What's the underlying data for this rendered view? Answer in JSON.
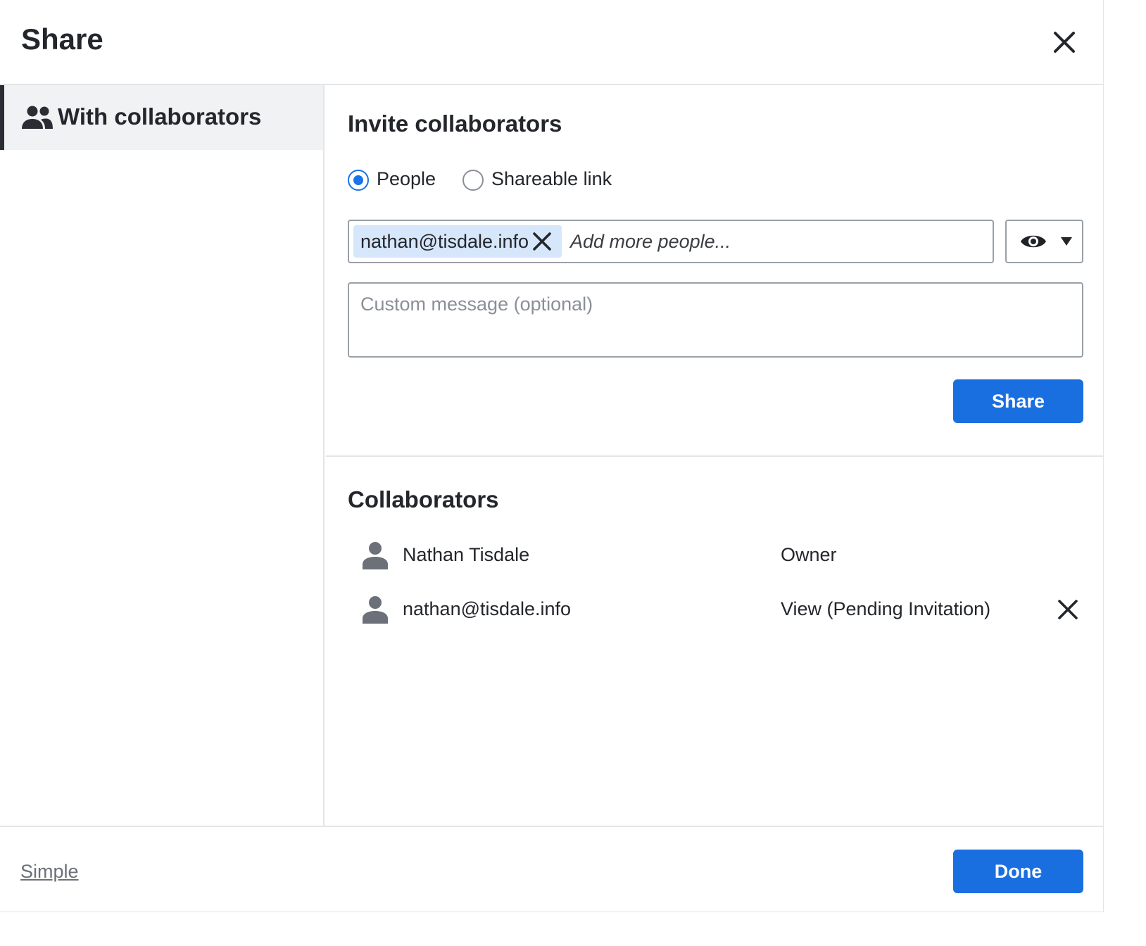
{
  "dialog": {
    "title": "Share"
  },
  "sidebar": {
    "items": [
      {
        "label": "With collaborators",
        "icon": "people-icon",
        "selected": true
      }
    ]
  },
  "invite": {
    "heading": "Invite collaborators",
    "radios": [
      {
        "label": "People",
        "checked": true
      },
      {
        "label": "Shareable link",
        "checked": false
      }
    ],
    "chips": [
      {
        "email": "nathan@tisdale.info"
      }
    ],
    "add_placeholder": "Add more people...",
    "permission_icon": "eye-icon",
    "message_placeholder": "Custom message (optional)",
    "share_label": "Share"
  },
  "collaborators": {
    "heading": "Collaborators",
    "rows": [
      {
        "name": "Nathan Tisdale",
        "role": "Owner",
        "removable": false
      },
      {
        "name": "nathan@tisdale.info",
        "role": "View (Pending Invitation)",
        "removable": true
      }
    ]
  },
  "footer": {
    "simple_label": "Simple",
    "done_label": "Done"
  },
  "colors": {
    "accent": "#1a6fe0",
    "chip_bg": "#d6e6fb",
    "sidebar_selected_bg": "#f1f2f4"
  }
}
